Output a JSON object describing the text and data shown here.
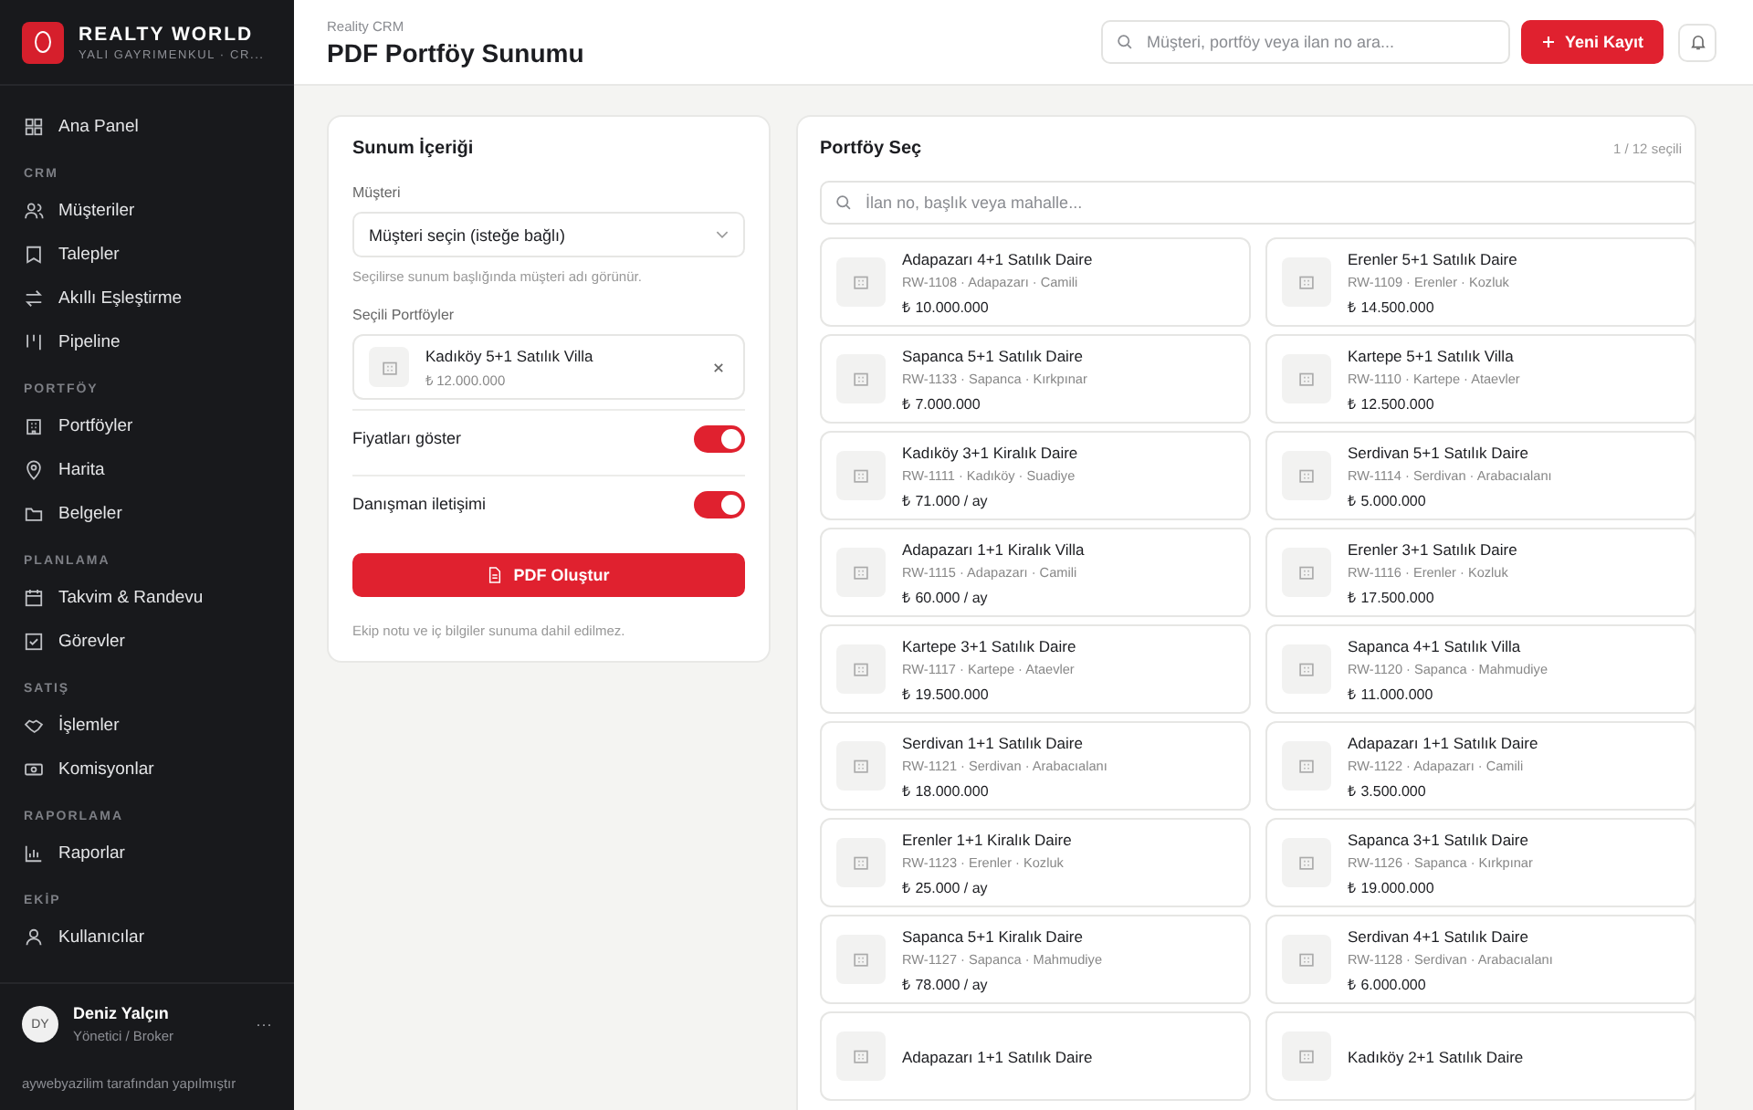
{
  "brand": {
    "name": "REALTY WORLD",
    "subtitle": "YALI GAYRIMENKUL · CR..."
  },
  "sidebar": {
    "top_item": {
      "label": "Ana Panel"
    },
    "sections": [
      {
        "title": "CRM",
        "items": [
          {
            "label": "Müşteriler"
          },
          {
            "label": "Talepler"
          },
          {
            "label": "Akıllı Eşleştirme"
          },
          {
            "label": "Pipeline"
          }
        ]
      },
      {
        "title": "PORTFÖY",
        "items": [
          {
            "label": "Portföyler"
          },
          {
            "label": "Harita"
          },
          {
            "label": "Belgeler"
          }
        ]
      },
      {
        "title": "PLANLAMA",
        "items": [
          {
            "label": "Takvim & Randevu"
          },
          {
            "label": "Görevler"
          }
        ]
      },
      {
        "title": "SATIŞ",
        "items": [
          {
            "label": "İşlemler"
          },
          {
            "label": "Komisyonlar"
          }
        ]
      },
      {
        "title": "RAPORLAMA",
        "items": [
          {
            "label": "Raporlar"
          }
        ]
      },
      {
        "title": "EKİP",
        "items": [
          {
            "label": "Kullanıcılar"
          }
        ]
      }
    ],
    "user": {
      "initials": "DY",
      "name": "Deniz Yalçın",
      "role": "Yönetici / Broker",
      "menu": "···"
    },
    "credit": "aywebyazilim tarafından yapılmıştır"
  },
  "header": {
    "breadcrumb": "Reality CRM",
    "title": "PDF Portföy Sunumu",
    "search_placeholder": "Müşteri, portföy veya ilan no ara...",
    "new_button": "Yeni Kayıt"
  },
  "content_panel": {
    "title": "Sunum İçeriği",
    "customer_label": "Müşteri",
    "customer_select": "Müşteri seçin (isteğe bağlı)",
    "customer_hint": "Seçilirse sunum başlığında müşteri adı görünür.",
    "selected_label": "Seçili Portföyler",
    "selected_items": [
      {
        "title": "Kadıköy 5+1 Satılık Villa",
        "price": "₺ 12.000.000"
      }
    ],
    "toggles": [
      {
        "label": "Fiyatları göster",
        "on": true
      },
      {
        "label": "Danışman iletişimi",
        "on": true
      }
    ],
    "generate_button": "PDF Oluştur",
    "footnote": "Ekip notu ve iç bilgiler sunuma dahil edilmez."
  },
  "portfolio_panel": {
    "title": "Portföy Seç",
    "count": "1 / 12 seçili",
    "search_placeholder": "İlan no, başlık veya mahalle...",
    "items": [
      {
        "title": "Adapazarı 4+1 Satılık Daire",
        "meta": "RW-1108 · Adapazarı · Camili",
        "price": "₺ 10.000.000"
      },
      {
        "title": "Erenler 5+1 Satılık Daire",
        "meta": "RW-1109 · Erenler · Kozluk",
        "price": "₺ 14.500.000"
      },
      {
        "title": "Sapanca 5+1 Satılık Daire",
        "meta": "RW-1133 · Sapanca · Kırkpınar",
        "price": "₺ 7.000.000"
      },
      {
        "title": "Kartepe 5+1 Satılık Villa",
        "meta": "RW-1110 · Kartepe · Ataevler",
        "price": "₺ 12.500.000"
      },
      {
        "title": "Kadıköy 3+1 Kiralık Daire",
        "meta": "RW-1111 · Kadıköy · Suadiye",
        "price": "₺ 71.000 / ay"
      },
      {
        "title": "Serdivan 5+1 Satılık Daire",
        "meta": "RW-1114 · Serdivan · Arabacıalanı",
        "price": "₺ 5.000.000"
      },
      {
        "title": "Adapazarı 1+1 Kiralık Villa",
        "meta": "RW-1115 · Adapazarı · Camili",
        "price": "₺ 60.000 / ay"
      },
      {
        "title": "Erenler 3+1 Satılık Daire",
        "meta": "RW-1116 · Erenler · Kozluk",
        "price": "₺ 17.500.000"
      },
      {
        "title": "Kartepe 3+1 Satılık Daire",
        "meta": "RW-1117 · Kartepe · Ataevler",
        "price": "₺ 19.500.000"
      },
      {
        "title": "Sapanca 4+1 Satılık Villa",
        "meta": "RW-1120 · Sapanca · Mahmudiye",
        "price": "₺ 11.000.000"
      },
      {
        "title": "Serdivan 1+1 Satılık Daire",
        "meta": "RW-1121 · Serdivan · Arabacıalanı",
        "price": "₺ 18.000.000"
      },
      {
        "title": "Adapazarı 1+1 Satılık Daire",
        "meta": "RW-1122 · Adapazarı · Camili",
        "price": "₺ 3.500.000"
      },
      {
        "title": "Erenler 1+1 Kiralık Daire",
        "meta": "RW-1123 · Erenler · Kozluk",
        "price": "₺ 25.000 / ay"
      },
      {
        "title": "Sapanca 3+1 Satılık Daire",
        "meta": "RW-1126 · Sapanca · Kırkpınar",
        "price": "₺ 19.000.000"
      },
      {
        "title": "Sapanca 5+1 Kiralık Daire",
        "meta": "RW-1127 · Sapanca · Mahmudiye",
        "price": "₺ 78.000 / ay"
      },
      {
        "title": "Serdivan 4+1 Satılık Daire",
        "meta": "RW-1128 · Serdivan · Arabacıalanı",
        "price": "₺ 6.000.000"
      },
      {
        "title": "Adapazarı 1+1 Satılık Daire"
      },
      {
        "title": "Kadıköy 2+1 Satılık Daire"
      }
    ]
  }
}
